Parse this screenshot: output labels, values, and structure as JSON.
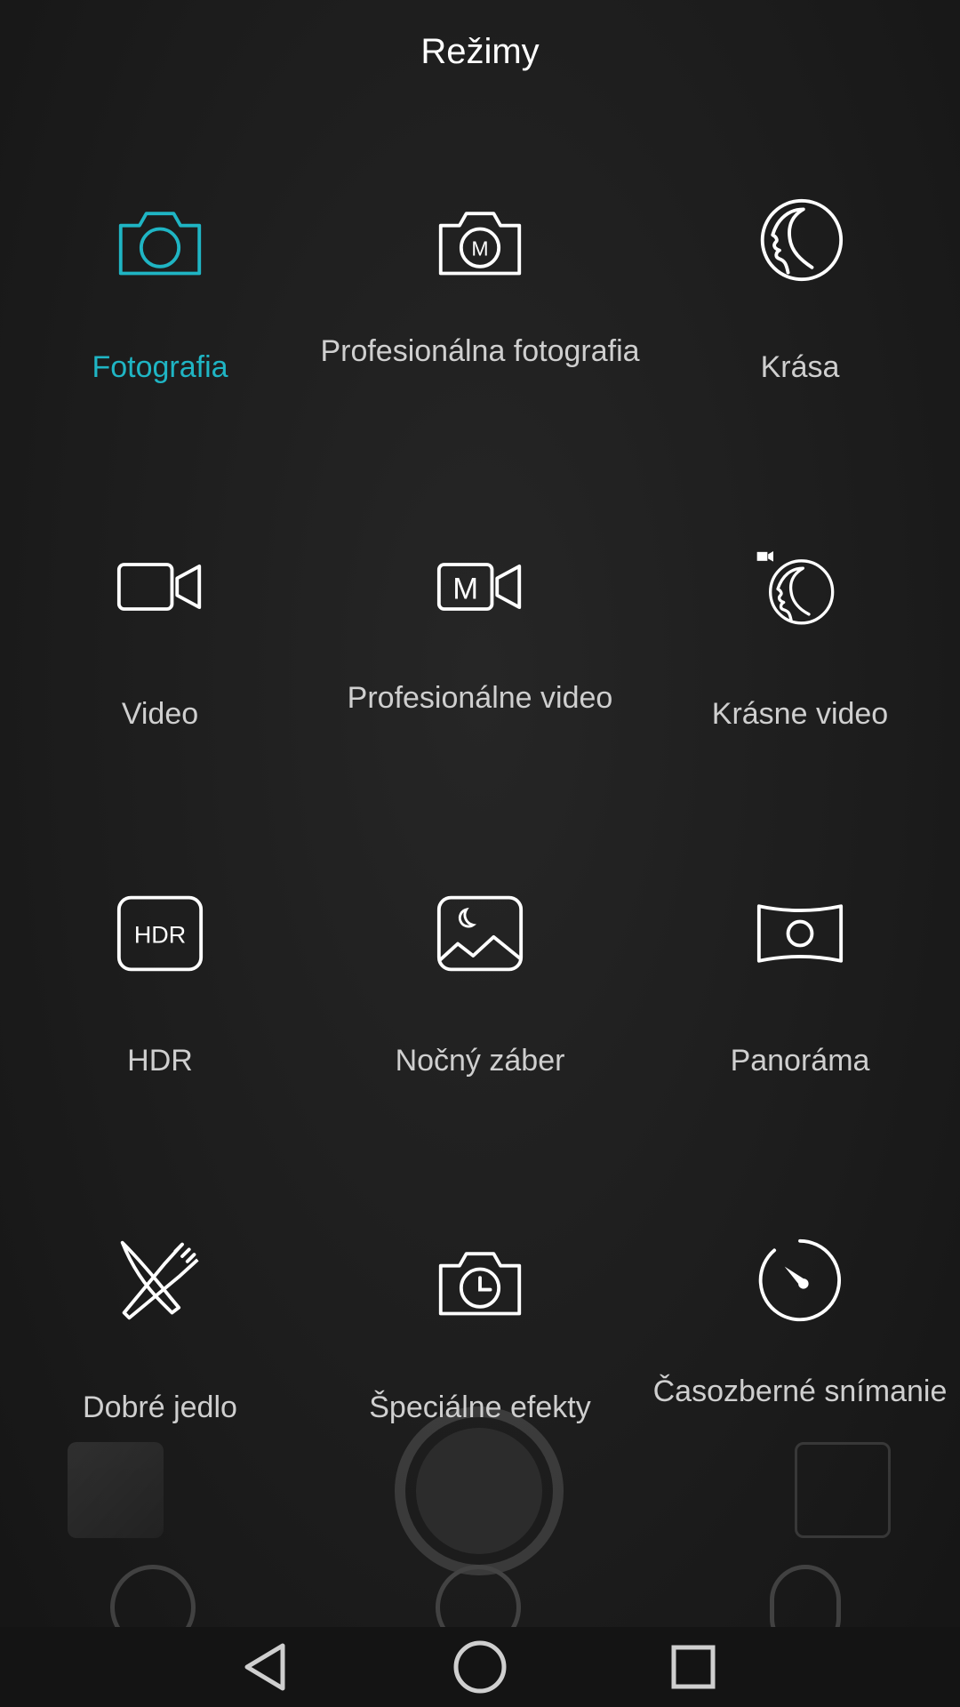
{
  "header": {
    "title": "Režimy"
  },
  "modes": [
    {
      "label": "Fotografia",
      "icon": "camera-icon",
      "active": true
    },
    {
      "label": "Profesionálna fotografia",
      "icon": "pro-camera-icon",
      "active": false
    },
    {
      "label": "Krása",
      "icon": "beauty-face-icon",
      "active": false
    },
    {
      "label": "Video",
      "icon": "video-camera-icon",
      "active": false
    },
    {
      "label": "Profesionálne video",
      "icon": "pro-video-icon",
      "active": false
    },
    {
      "label": "Krásne video",
      "icon": "beauty-video-icon",
      "active": false
    },
    {
      "label": "HDR",
      "icon": "hdr-icon",
      "active": false
    },
    {
      "label": "Nočný záber",
      "icon": "night-shot-icon",
      "active": false
    },
    {
      "label": "Panoráma",
      "icon": "panorama-icon",
      "active": false
    },
    {
      "label": "Dobré jedlo",
      "icon": "fork-knife-icon",
      "active": false
    },
    {
      "label": "Špeciálne efekty",
      "icon": "special-effects-camera-icon",
      "active": false
    },
    {
      "label": "Časozberné snímanie",
      "icon": "timelapse-icon",
      "active": false
    }
  ],
  "icon_labels": {
    "pro": "M",
    "hdr": "HDR"
  },
  "colors": {
    "active": "#1fb5c4",
    "icon": "#ffffff",
    "label": "#cfcfcf",
    "background": "#1b1b1b"
  },
  "navbar": {
    "back": "back-triangle-icon",
    "home": "home-circle-icon",
    "recents": "recents-square-icon"
  }
}
